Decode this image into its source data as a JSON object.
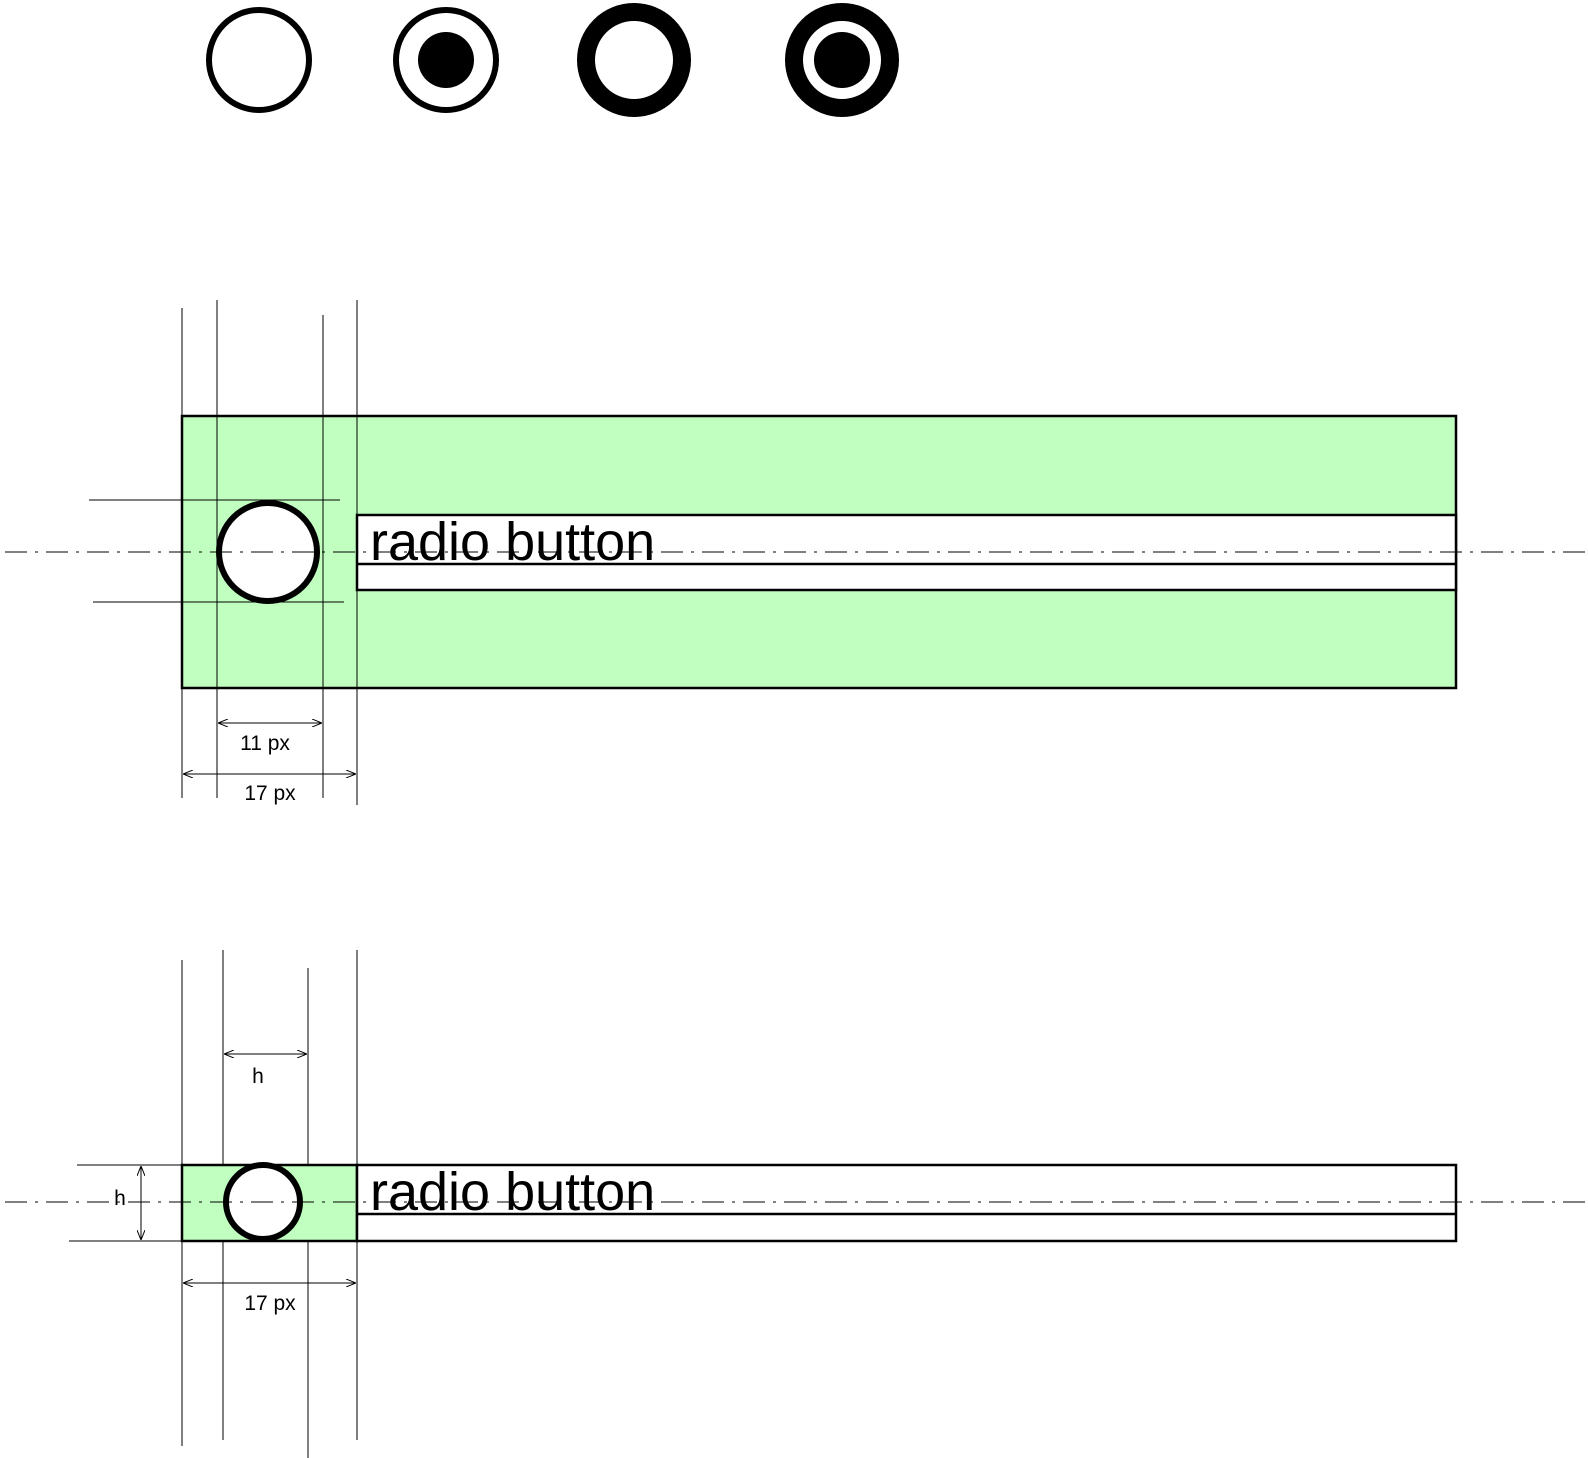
{
  "colors": {
    "hit_area": "#c0ffc0",
    "stroke": "#000000",
    "background": "#ffffff"
  },
  "states": [
    {
      "name": "unchecked",
      "selected": false,
      "emphasis": "normal"
    },
    {
      "name": "checked",
      "selected": true,
      "emphasis": "normal"
    },
    {
      "name": "unchecked-emphasized",
      "selected": false,
      "emphasis": "heavy"
    },
    {
      "name": "checked-emphasized",
      "selected": true,
      "emphasis": "heavy"
    }
  ],
  "large_spec": {
    "label": "radio button",
    "inner_dimension": "11 px",
    "outer_dimension": "17 px"
  },
  "compact_spec": {
    "label": "radio button",
    "circle_width_dimension": "h",
    "row_height_dimension": "h",
    "outer_dimension": "17 px"
  }
}
